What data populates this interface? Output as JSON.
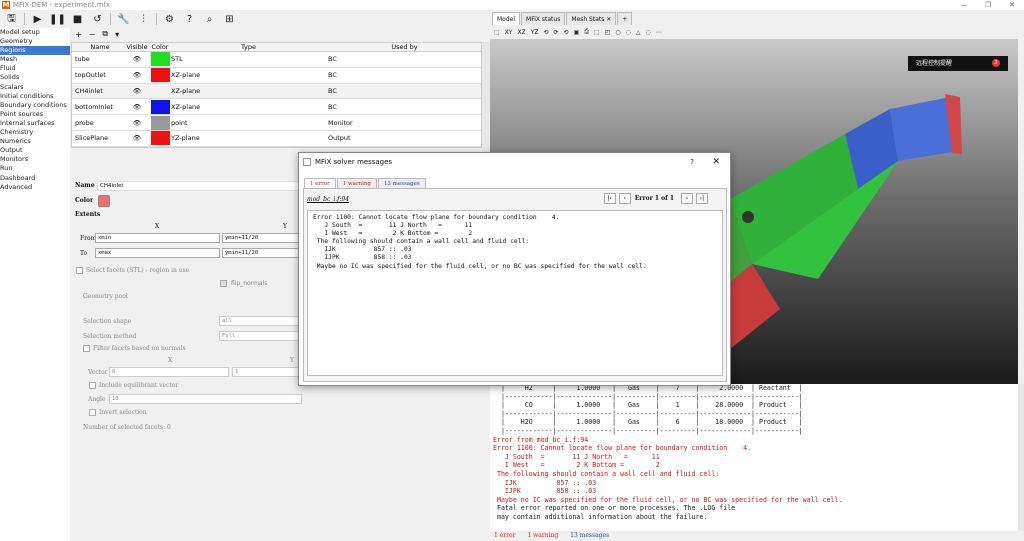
{
  "window": {
    "title": "MFiX-DEM - experiment.mfx"
  },
  "nav": {
    "items": [
      "Model setup",
      "Geometry",
      "Regions",
      "Mesh",
      "Fluid",
      "Solids",
      "Scalars",
      "Initial conditions",
      "Boundary conditions",
      "Point sources",
      "Internal surfaces",
      "Chemistry",
      "Numerics",
      "Output",
      "Monitors",
      "Run",
      "Dashboard",
      "Advanced"
    ],
    "selected": "Regions"
  },
  "regions": {
    "toolbar": [
      "+",
      "−",
      "⧉",
      "▾"
    ],
    "columns": [
      "Name",
      "Visible",
      "Color",
      "Type",
      "Used by"
    ],
    "rows": [
      {
        "name": "tube",
        "type": "STL",
        "used_by": "BC",
        "color": "#22dd22"
      },
      {
        "name": "topOutlet",
        "type": "XZ-plane",
        "used_by": "BC",
        "color": "#ee1111"
      },
      {
        "name": "CH4inlet",
        "type": "XZ-plane",
        "used_by": "BC",
        "color": "#f2f2f2"
      },
      {
        "name": "bottomInlet",
        "type": "XZ-plane",
        "used_by": "BC",
        "color": "#1111ee"
      },
      {
        "name": "probe",
        "type": "point",
        "used_by": "Monitor",
        "color": "#999999"
      },
      {
        "name": "SlicePlane",
        "type": "YZ-plane",
        "used_by": "Output",
        "color": "#ee1111"
      }
    ],
    "detail": {
      "name_label": "Name",
      "name_value": "CH4inlet",
      "color_label": "Color",
      "color_value": "#f07070",
      "extents_label": "Extents",
      "x_header": "X",
      "y_header": "Y",
      "from_label": "From",
      "to_label": "To",
      "from_x": "xmin",
      "from_y": "ymin+11/20",
      "to_x": "xmax",
      "to_y": "ymin+11/20",
      "select_facets": "Select facets (STL) - region in use",
      "flip_normals": "flip_normals",
      "geometry_pool": "Geometry pool",
      "selection_shape_label": "Selection shape",
      "selection_shape": "all",
      "selection_method_label": "Selection method",
      "selection_method": "Full",
      "filter_facets": "Filter facets based on normals",
      "vx_header": "X",
      "vy_header": "Y",
      "vector_label": "Vector",
      "vector_x": "0",
      "vector_y": "1",
      "include_equilibrant": "Include equilibrant vector",
      "angle_label": "Angle",
      "angle_value": "10",
      "invert_selection": "Invert selection",
      "num_selected": "Number of selected facets: 0"
    }
  },
  "tabs": [
    "Model",
    "MFiX status",
    "Mesh Stats",
    "+"
  ],
  "viewer_toolbar": [
    "⬚",
    "XY",
    "XZ",
    "YZ",
    "⟲",
    "⟳",
    "⟲",
    "▣",
    "⎙",
    "⬚",
    "◰",
    "○",
    "◌",
    "△",
    "◌",
    "⋯"
  ],
  "remote": {
    "label": "远程控制提醒",
    "count": "2"
  },
  "console": {
    "lines": [
      {
        "t": "  |     H2     |     1.0000   |   Gas    |    7    |     2.0000  | Reactant  |",
        "err": false
      },
      {
        "t": "  |------------|--------------|----------|---------|-------------|-----------|",
        "err": false
      },
      {
        "t": "  |     CO     |     1.0000   |   Gas    |    1    |    28.0000  | Product   |",
        "err": false
      },
      {
        "t": "  |------------|--------------|----------|---------|-------------|-----------|",
        "err": false
      },
      {
        "t": "  |    H2O     |     1.0000   |   Gas    |    6    |    18.0000  | Product   |",
        "err": false
      },
      {
        "t": "  |------------|--------------|----------|---------|-------------|-----------|",
        "err": false
      },
      {
        "t": "Error from mod_bc_i.f:94",
        "err": true
      },
      {
        "t": "Error 1100: Cannot locate flow plane for boundary condition    4.",
        "err": true
      },
      {
        "t": "   J South  =       11 J North   =      11",
        "err": true
      },
      {
        "t": "   I West   =        2 K Bottom =        2",
        "err": true
      },
      {
        "t": " The following should contain a wall cell and fluid cell:",
        "err": true
      },
      {
        "t": "   IJK          857 :: .03",
        "err": true
      },
      {
        "t": "   IJPK         858 :: .03",
        "err": true
      },
      {
        "t": " Maybe no IC was specified for the fluid cell, or no BC was specified for the wall cell.",
        "err": true
      },
      {
        "t": " Fatal error reported on one or more processes. The .LOG file",
        "err": false
      },
      {
        "t": " may contain additional information about the failure.",
        "err": false
      }
    ],
    "tabs": {
      "errors": "1 error",
      "warnings": "1 warning",
      "messages": "13 messages"
    }
  },
  "dialog": {
    "title": "MFiX solver messages",
    "help": "?",
    "close": "✕",
    "tabs": {
      "errors": "1 error",
      "warnings": "1 warning",
      "messages": "13 messages"
    },
    "file": "mod_bc_i.f:94",
    "pager": {
      "first": "|‹",
      "prev": "‹",
      "label": "Error 1 of 1",
      "next": "›",
      "last": "›|"
    },
    "lines": [
      "Error 1100: Cannot locate flow plane for boundary condition    4.",
      "   J South  =       11 J North   =      11",
      "   I West   =        2 K Bottom =        2",
      " The following should contain a wall cell and fluid cell:",
      "   IJK          857 :: .03",
      "   IJPK         858 :: .03",
      " Maybe no IC was specified for the fluid cell, or no BC was specified for the wall cell."
    ]
  }
}
